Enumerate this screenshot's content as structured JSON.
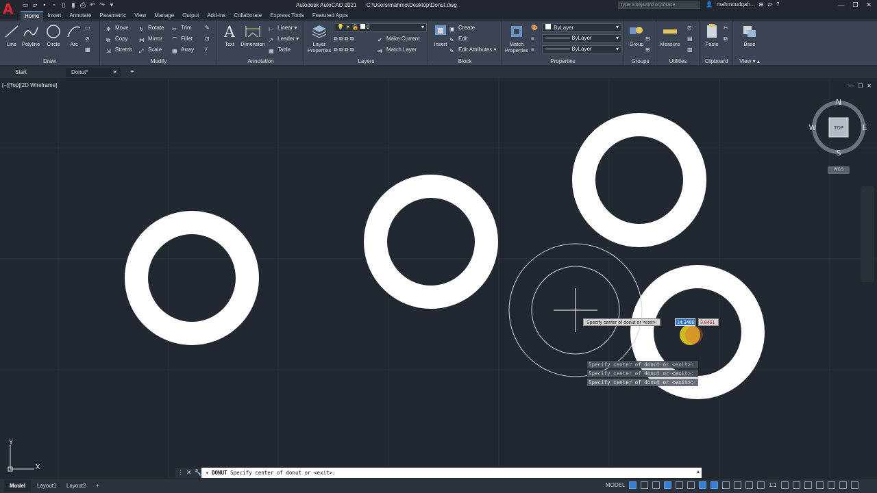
{
  "app": {
    "title": "Autodesk AutoCAD 2021",
    "file_path": "C:\\Users\\mahmo\\Desktop\\Donut.dwg",
    "search_placeholder": "Type a keyword or phrase",
    "user": "mahmoudqah..."
  },
  "ribbon_tabs": [
    "Home",
    "Insert",
    "Annotate",
    "Parametric",
    "View",
    "Manage",
    "Output",
    "Add-ins",
    "Collaborate",
    "Express Tools",
    "Featured Apps"
  ],
  "active_ribbon_tab": "Home",
  "panels": {
    "draw": {
      "title": "Draw",
      "tools": [
        "Line",
        "Polyline",
        "Circle",
        "Arc"
      ]
    },
    "modify": {
      "title": "Modify",
      "tools": [
        "Move",
        "Rotate",
        "Trim",
        "Copy",
        "Mirror",
        "Fillet",
        "Stretch",
        "Scale",
        "Array"
      ]
    },
    "annotation": {
      "title": "Annotation",
      "big": [
        "Text",
        "Dimension"
      ],
      "small": [
        "Linear",
        "Leader",
        "Table"
      ]
    },
    "layers": {
      "title": "Layers",
      "big": "Layer Properties",
      "current_layer": "0",
      "small": [
        "Make Current",
        "Match Layer"
      ]
    },
    "block": {
      "title": "Block",
      "big": "Insert",
      "small": [
        "Create",
        "Edit",
        "Edit Attributes"
      ]
    },
    "properties": {
      "title": "Properties",
      "big": "Match Properties",
      "color": "ByLayer",
      "linetype": "ByLayer",
      "lineweight": "ByLayer"
    },
    "groups": {
      "title": "Groups",
      "big": "Group"
    },
    "utilities": {
      "title": "Utilities",
      "big": "Measure"
    },
    "clipboard": {
      "title": "Clipboard",
      "big": "Paste"
    },
    "view": {
      "title": "View",
      "big": "Base"
    }
  },
  "doc_tabs": [
    "Start",
    "Donut*"
  ],
  "viewport": {
    "label": "[−][Top][2D Wireframe]",
    "viewcube": {
      "n": "N",
      "s": "S",
      "e": "E",
      "w": "W",
      "face": "TOP"
    },
    "wcs": "WCS",
    "tooltip": "Specify center of donut or <exit>:",
    "coord_x": "14.3466",
    "coord_y": "3.8491",
    "ucs_x": "X",
    "ucs_y": "Y"
  },
  "command_history": [
    "Specify center of donut or <exit>:",
    "Specify center of donut or <exit>:",
    "Specify center of donut or <exit>:"
  ],
  "command_line": {
    "command": "DONUT",
    "prompt": "Specify center of donut or <exit>:"
  },
  "status_tabs": [
    "Model",
    "Layout1",
    "Layout2"
  ],
  "status_right": {
    "model_label": "MODEL",
    "scale": "1:1"
  },
  "colors": {
    "background": "#212830",
    "ribbon": "#3b4453",
    "donut": "#ffffff",
    "accent": "#3a7bd5"
  }
}
